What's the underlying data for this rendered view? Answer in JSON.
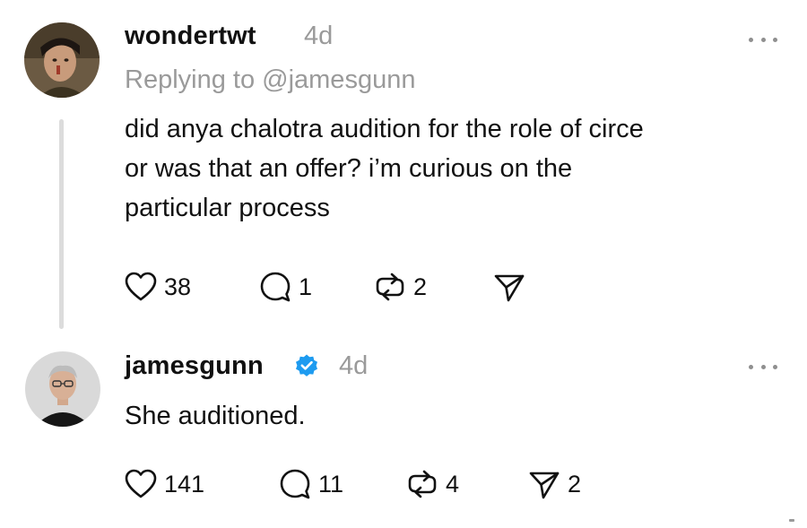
{
  "posts": [
    {
      "username": "wondertwt",
      "time": "4d",
      "replying_to": "Replying to @jamesgunn",
      "text_lines": [
        "did anya chalotra audition for the role of circe",
        "or was that an offer? i’m curious on the",
        "particular process"
      ],
      "verified": false,
      "actions": {
        "likes": "38",
        "replies": "1",
        "reposts": "2",
        "shares": ""
      }
    },
    {
      "username": "jamesgunn",
      "time": "4d",
      "text_lines": [
        "She auditioned."
      ],
      "verified": true,
      "actions": {
        "likes": "141",
        "replies": "11",
        "reposts": "4",
        "shares": "2"
      }
    }
  ],
  "icons": {
    "like": "heart-icon",
    "reply": "comment-icon",
    "repost": "repost-icon",
    "share": "send-icon",
    "more": "more-options-icon",
    "verified": "verified-badge-icon"
  },
  "colors": {
    "text": "#111111",
    "muted": "#9a9a9a",
    "verified": "#1d9bf0",
    "thread_line": "#dcdcdc"
  }
}
